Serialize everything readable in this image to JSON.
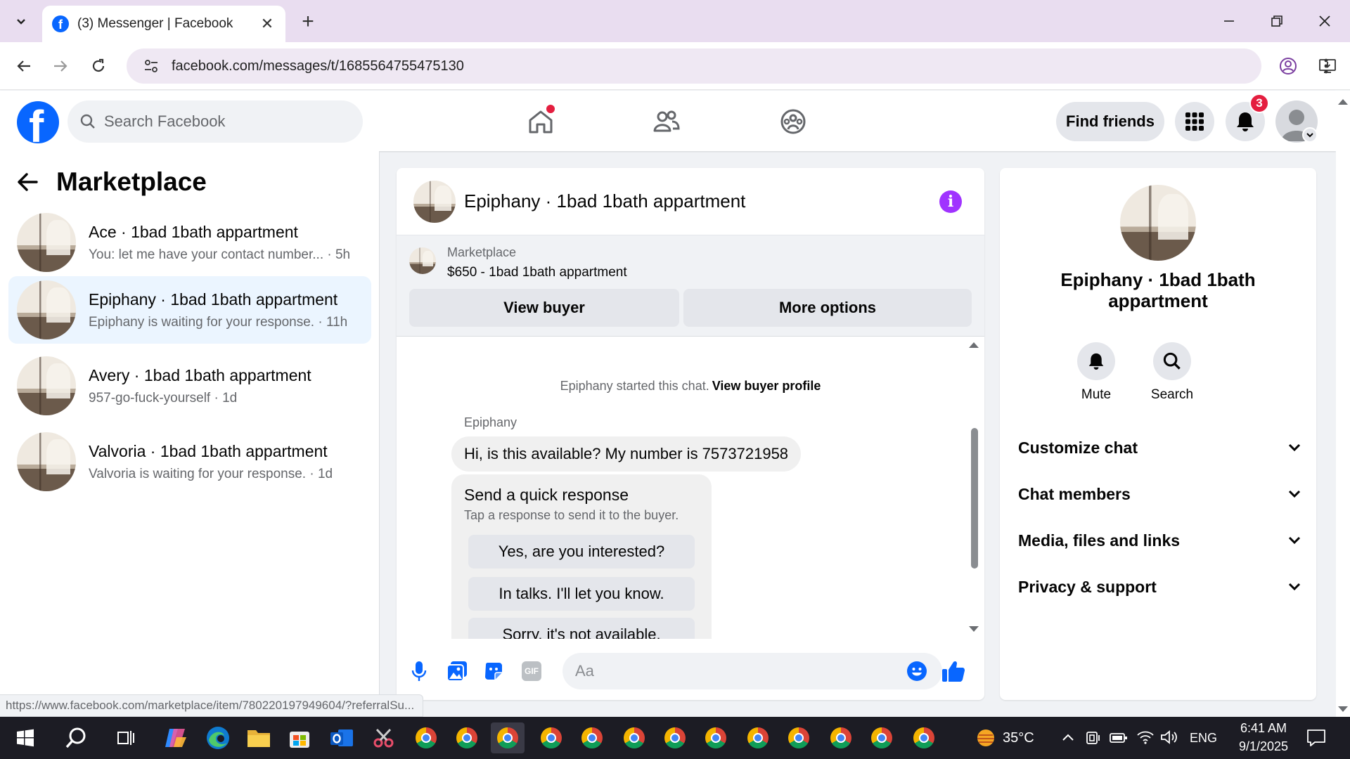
{
  "browser": {
    "tab_title": "(3) Messenger | Facebook",
    "url": "facebook.com/messages/t/1685564755475130",
    "status_url": "https://www.facebook.com/marketplace/item/780220197949604/?referralSu..."
  },
  "fb_header": {
    "search_placeholder": "Search Facebook",
    "find_friends": "Find friends",
    "notification_count": "3"
  },
  "sidebar": {
    "title": "Marketplace",
    "conversations": [
      {
        "name": "Ace · 1bad 1bath appartment",
        "snippet": "You: let me have your contact number... · 5h",
        "active": false
      },
      {
        "name": "Epiphany · 1bad 1bath appartment",
        "snippet": "Epiphany is waiting for your response. · 11h",
        "active": true
      },
      {
        "name": "Avery · 1bad 1bath appartment",
        "snippet": "957-go-fuck-yourself · 1d",
        "active": false
      },
      {
        "name": "Valvoria · 1bad 1bath appartment",
        "snippet": "Valvoria is waiting for your response. · 1d",
        "active": false
      }
    ]
  },
  "chat": {
    "title": "Epiphany · 1bad 1bath appartment",
    "listing_label": "Marketplace",
    "listing_price_title": "$650 - 1bad 1bath appartment",
    "view_buyer": "View buyer",
    "more_options": "More options",
    "system_text": "Epiphany started this chat.",
    "system_link": "View buyer profile",
    "sender": "Epiphany",
    "message": "Hi, is this available? My number is 7573721958",
    "quick_title": "Send a quick response",
    "quick_subtitle": "Tap a response to send it to the buyer.",
    "quick_replies": [
      "Yes, are you interested?",
      "In talks. I'll let you know.",
      "Sorry, it's not available."
    ],
    "composer_placeholder": "Aa",
    "gif_label": "GIF"
  },
  "info_panel": {
    "name": "Epiphany · 1bad 1bath appartment",
    "mute": "Mute",
    "search": "Search",
    "rows": [
      "Customize chat",
      "Chat members",
      "Media, files and links",
      "Privacy & support"
    ]
  },
  "taskbar": {
    "temperature": "35°C",
    "language": "ENG",
    "time": "6:41 AM",
    "date": "9/1/2025"
  },
  "colors": {
    "facebook_blue": "#0866ff",
    "messenger_purple": "#a033ff",
    "notification_red": "#e41e3f"
  }
}
